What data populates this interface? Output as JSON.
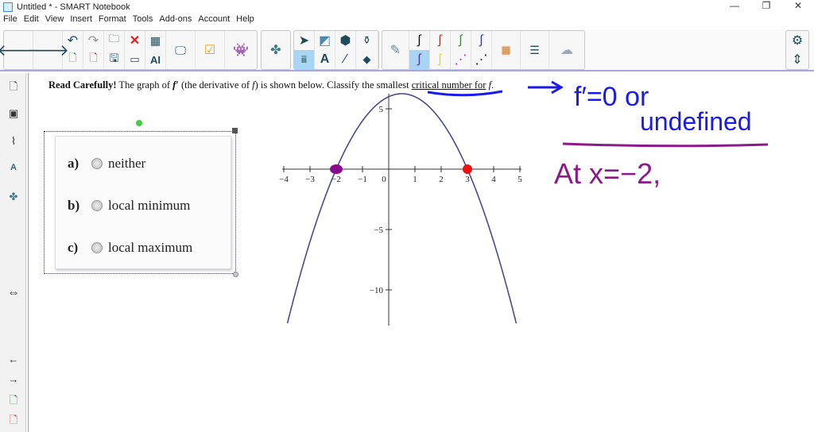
{
  "window": {
    "title": "Untitled * - SMART Notebook",
    "minimize": "—",
    "restore": "❐",
    "close": "✕"
  },
  "menu": [
    "File",
    "Edit",
    "View",
    "Insert",
    "Format",
    "Tools",
    "Add-ons",
    "Account",
    "Help"
  ],
  "question": {
    "bold": "Read Carefully!",
    "part1": " The graph of ",
    "fprime": "f′",
    "part2": " (the derivative of ",
    "f": "f",
    "part3": ") is shown below. Classify the smallest ",
    "underlined": "critical number for",
    "part4": " ",
    "f2": "f",
    "end": "."
  },
  "answers": [
    {
      "letter": "a)",
      "text": "neither"
    },
    {
      "letter": "b)",
      "text": "local minimum"
    },
    {
      "letter": "c)",
      "text": "local maximum"
    }
  ],
  "chart_data": {
    "type": "line",
    "function": "-(x+2)(x-3)",
    "x_ticks": [
      -4,
      -3,
      -2,
      -1,
      0,
      1,
      2,
      3,
      4,
      5
    ],
    "x_tick_labels": [
      "−4",
      "−3",
      "−2",
      "−1",
      "0",
      "1",
      "2",
      "3",
      "4",
      "5"
    ],
    "y_ticks": [
      5,
      -5,
      -10
    ],
    "y_tick_labels": [
      "5",
      "−5",
      "−10"
    ],
    "xlim": [
      -4,
      5
    ],
    "ylim": [
      -12.8,
      6.5
    ],
    "line_color": "#4a4a8c",
    "points": [
      {
        "x": -2,
        "y": 0,
        "color": "#8b0a8b"
      },
      {
        "x": 3,
        "y": 0,
        "color": "#ee1111"
      }
    ]
  },
  "annotations": {
    "line1": "f′=0 or",
    "line2": "undefined",
    "line3": "At x=−2,",
    "blue": "#1a1aee",
    "purple": "#8b1a8b"
  }
}
